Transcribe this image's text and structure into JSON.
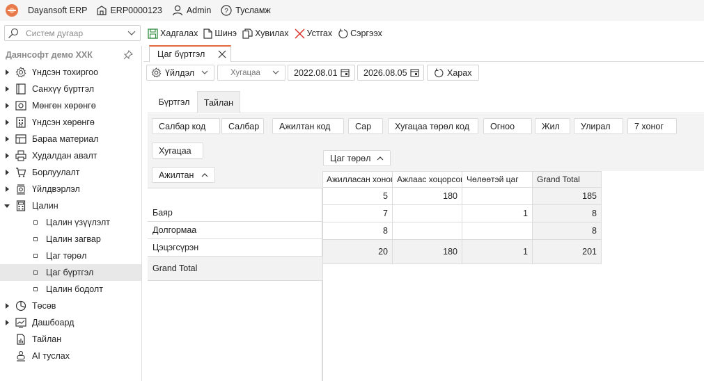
{
  "app": {
    "title": "Dayansoft ERP",
    "db": "ERP0000123",
    "user": "Admin",
    "help": "Тусламж"
  },
  "search": {
    "placeholder": "Систем дугаар"
  },
  "toolbar": {
    "save": "Хадгалах",
    "new": "Шинэ",
    "copy": "Хувилах",
    "delete": "Устгах",
    "refresh": "Сэргээх"
  },
  "sidebar": {
    "company": "Даянсофт демо ХХК",
    "items": [
      {
        "label": "Үндсэн тохиргоо",
        "icon": "gear-icon"
      },
      {
        "label": "Санхүү бүртгэл",
        "icon": "ledger-icon"
      },
      {
        "label": "Мөнгөн хөрөнгө",
        "icon": "cash-icon"
      },
      {
        "label": "Үндсэн хөрөнгө",
        "icon": "building-icon"
      },
      {
        "label": "Бараа материал",
        "icon": "inventory-icon"
      },
      {
        "label": "Худалдан авалт",
        "icon": "printer-icon"
      },
      {
        "label": "Борлуулалт",
        "icon": "cart-icon"
      },
      {
        "label": "Үйлдвэрлэл",
        "icon": "factory-icon"
      },
      {
        "label": "Цалин",
        "icon": "calculator-icon"
      }
    ],
    "sub_items": [
      {
        "label": "Цалин үзүүлэлт"
      },
      {
        "label": "Цалин загвар"
      },
      {
        "label": "Цаг төрөл"
      },
      {
        "label": "Цаг бүртгэл"
      },
      {
        "label": "Цалин бодолт"
      }
    ],
    "bottom_items": [
      {
        "label": "Төсөв",
        "icon": "pie-icon"
      },
      {
        "label": "Дашбоард",
        "icon": "dashboard-icon"
      },
      {
        "label": "Тайлан",
        "icon": "report-icon"
      },
      {
        "label": "AI туслах",
        "icon": "ai-icon"
      }
    ]
  },
  "doc_tab": {
    "label": "Цаг бүртгэл"
  },
  "filters": {
    "operation": "Үйлдэл",
    "period": "Хугацаа",
    "date_from": "2022.08.01",
    "date_to": "2026.08.05",
    "view": "Харах"
  },
  "tabs": [
    {
      "label": "Бүртгэл"
    },
    {
      "label": "Тайлан"
    }
  ],
  "pivot": {
    "fields": [
      "Салбар код",
      "Салбар",
      "Ажилтан код",
      "Сар",
      "Хугацаа төрөл код",
      "Огноо",
      "Жил",
      "Улирал",
      "7 хоног",
      "Хугацаа"
    ],
    "row_field": "Ажилтан",
    "column_field": "Цаг төрөл",
    "columns": [
      "Ажилласан хоног",
      "Ажлаас хоцорсон",
      "Чөлөөтэй цаг",
      "Grand Total"
    ],
    "rows": [
      {
        "name": "Баяр",
        "values": [
          "5",
          "180",
          "",
          "185"
        ]
      },
      {
        "name": "Долгормаа",
        "values": [
          "7",
          "",
          "1",
          "8"
        ]
      },
      {
        "name": "Цэцэгсүрэн",
        "values": [
          "8",
          "",
          "",
          "8"
        ]
      }
    ],
    "total": {
      "name": "Grand Total",
      "values": [
        "20",
        "180",
        "1",
        "201"
      ]
    }
  }
}
